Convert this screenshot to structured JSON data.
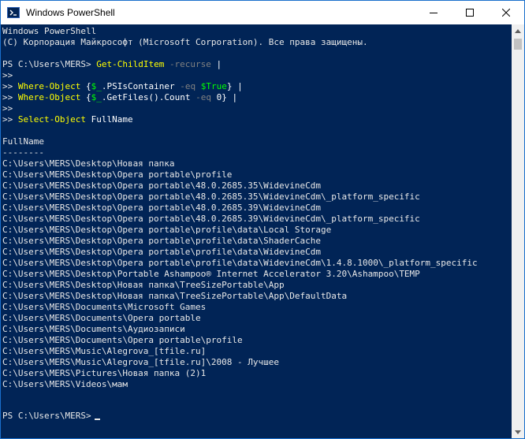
{
  "window": {
    "title": "Windows PowerShell"
  },
  "console": {
    "banner": [
      "Windows PowerShell",
      "(C) Корпорация Майкрософт (Microsoft Corporation). Все права защищены."
    ],
    "prompt": "PS C:\\Users\\MERS>",
    "command": {
      "get_childitem": "Get-ChildItem",
      "recurse_param": "-recurse",
      "pipe": "|",
      "continuation": ">>",
      "where_object": "Where-Object",
      "brace_open": "{",
      "dollar_var": "$_",
      "psicontainer": ".PSIsContainer",
      "eq_param": "-eq",
      "true_value": "$True",
      "brace_close": "}",
      "getfiles": ".GetFiles().Count",
      "zero_value": "0",
      "select_object": "Select-Object",
      "fullname_arg": "FullName"
    },
    "output_header": "FullName",
    "output_underline": "--------",
    "results": [
      "C:\\Users\\MERS\\Desktop\\Новая папка",
      "C:\\Users\\MERS\\Desktop\\Opera portable\\profile",
      "C:\\Users\\MERS\\Desktop\\Opera portable\\48.0.2685.35\\WidevineCdm",
      "C:\\Users\\MERS\\Desktop\\Opera portable\\48.0.2685.35\\WidevineCdm\\_platform_specific",
      "C:\\Users\\MERS\\Desktop\\Opera portable\\48.0.2685.39\\WidevineCdm",
      "C:\\Users\\MERS\\Desktop\\Opera portable\\48.0.2685.39\\WidevineCdm\\_platform_specific",
      "C:\\Users\\MERS\\Desktop\\Opera portable\\profile\\data\\Local Storage",
      "C:\\Users\\MERS\\Desktop\\Opera portable\\profile\\data\\ShaderCache",
      "C:\\Users\\MERS\\Desktop\\Opera portable\\profile\\data\\WidevineCdm",
      "C:\\Users\\MERS\\Desktop\\Opera portable\\profile\\data\\WidevineCdm\\1.4.8.1000\\_platform_specific",
      "C:\\Users\\MERS\\Desktop\\Portable Ashampoo® Internet Accelerator 3.20\\Ashampoo\\TEMP",
      "C:\\Users\\MERS\\Desktop\\Новая папка\\TreeSizePortable\\App",
      "C:\\Users\\MERS\\Desktop\\Новая папка\\TreeSizePortable\\App\\DefaultData",
      "C:\\Users\\MERS\\Documents\\Microsoft Games",
      "C:\\Users\\MERS\\Documents\\Opera portable",
      "C:\\Users\\MERS\\Documents\\Аудиозаписи",
      "C:\\Users\\MERS\\Documents\\Opera portable\\profile",
      "C:\\Users\\MERS\\Music\\Alegrova_[tfile.ru]",
      "C:\\Users\\MERS\\Music\\Alegrova_[tfile.ru]\\2008 - Лучшее",
      "C:\\Users\\MERS\\Pictures\\Новая папка (2)1",
      "C:\\Users\\MERS\\Videos\\мам"
    ]
  },
  "icons": {
    "app": "powershell-icon",
    "minimize": "minimize-icon",
    "maximize": "maximize-icon",
    "close": "close-icon",
    "scroll_up": "scroll-up-arrow-icon",
    "scroll_down": "scroll-down-arrow-icon"
  },
  "colors": {
    "console_background": "#012456",
    "cmdlet": "#ffff00",
    "parameter": "#808080",
    "variable": "#00ff00",
    "text": "#e8e8e8"
  }
}
